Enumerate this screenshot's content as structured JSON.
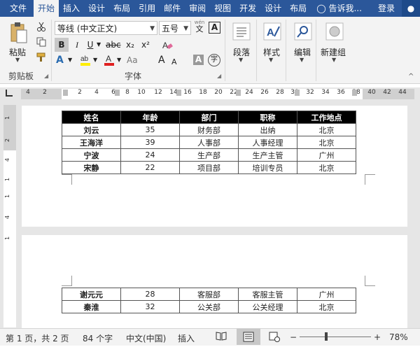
{
  "tabs": [
    "文件",
    "开始",
    "插入",
    "设计",
    "布局",
    "引用",
    "邮件",
    "审阅",
    "视图",
    "开发",
    "设计",
    "布局"
  ],
  "active_tab_index": 1,
  "tell_me": "告诉我...",
  "login": "登录",
  "ribbon": {
    "paste": "粘贴",
    "clipboard_group": "剪贴板",
    "font_group": "字体",
    "font_name": "等线 (中文正文)",
    "font_size": "五号",
    "wen": "wén",
    "wen_char": "文",
    "A_box": "A",
    "bold": "B",
    "italic": "I",
    "underline": "U",
    "strike": "abc",
    "sub": "x₂",
    "sup": "x²",
    "aa": "Aa",
    "grow": "A",
    "shrink": "A",
    "char_shade": "A",
    "char_circle": "字",
    "paragraph": "段落",
    "styles": "样式",
    "editing": "编辑",
    "new_group": "新建组"
  },
  "ruler_numbers": [
    "4",
    "2",
    "2",
    "4",
    "6",
    "8",
    "10",
    "12",
    "14",
    "16",
    "18",
    "20",
    "22",
    "24",
    "26",
    "28",
    "30",
    "32",
    "34",
    "36",
    "38",
    "40",
    "42",
    "44"
  ],
  "vruler_numbers": [
    "1",
    "2",
    "4",
    "1",
    "1",
    "4",
    "1"
  ],
  "table": {
    "headers": [
      "姓名",
      "年龄",
      "部门",
      "职称",
      "工作地点"
    ],
    "page1_rows": [
      [
        "刘云",
        "35",
        "财务部",
        "出纳",
        "北京"
      ],
      [
        "王海洋",
        "39",
        "人事部",
        "人事经理",
        "北京"
      ],
      [
        "宁波",
        "24",
        "生产部",
        "生产主管",
        "广州"
      ],
      [
        "宋静",
        "22",
        "项目部",
        "培训专员",
        "北京"
      ]
    ],
    "page2_rows": [
      [
        "谢元元",
        "28",
        "客服部",
        "客服主管",
        "广州"
      ],
      [
        "秦淮",
        "32",
        "公关部",
        "公关经理",
        "北京"
      ]
    ]
  },
  "status": {
    "page": "第 1 页，共 2 页",
    "words": "84 个字",
    "lang": "中文(中国)",
    "mode": "插入",
    "zoom": "78%",
    "minus": "−",
    "plus": "+"
  }
}
